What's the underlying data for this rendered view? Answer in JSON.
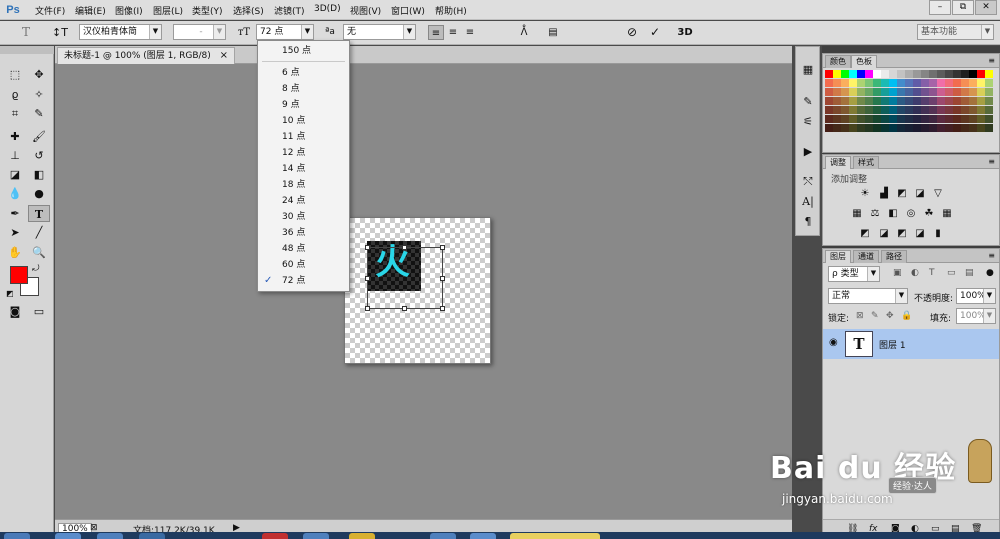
{
  "app": {
    "logo": "Ps"
  },
  "menubar": {
    "items": [
      "文件(F)",
      "编辑(E)",
      "图像(I)",
      "图层(L)",
      "类型(Y)",
      "选择(S)",
      "滤镜(T)",
      "3D(D)",
      "视图(V)",
      "窗口(W)",
      "帮助(H)"
    ],
    "window_buttons": [
      "–",
      "⧉",
      "✕"
    ]
  },
  "options": {
    "font_family": "汉仪柏青体简",
    "font_style": "-",
    "font_size": "72 点",
    "aa_label": "ªa",
    "aa_method": "无",
    "text_color": "#ff0000",
    "workspace": "基本功能",
    "commit_icon": "✓",
    "cancel_icon": "⊘",
    "mode_3d": "3D"
  },
  "font_size_menu": {
    "items": [
      "150 点",
      "6 点",
      "8 点",
      "9 点",
      "10 点",
      "11 点",
      "12 点",
      "14 点",
      "18 点",
      "24 点",
      "30 点",
      "36 点",
      "48 点",
      "60 点",
      "72 点"
    ],
    "selected": "72 点",
    "check": "✓"
  },
  "document": {
    "tab_title": "未标题-1 @ 100% (图层 1, RGB/8)",
    "close_icon": "×",
    "glyph": "火",
    "glyph_color": "#29d6e8"
  },
  "statusbar": {
    "zoom": "100%",
    "doc_info": "文档:117.2K/39.1K"
  },
  "colors_panel": {
    "tabs": [
      "颜色",
      "色板"
    ],
    "active_tab": "色板"
  },
  "adjustments_panel": {
    "tabs": [
      "调整",
      "样式"
    ],
    "title": "添加调整"
  },
  "layers_panel": {
    "tabs": [
      "图层",
      "通道",
      "路径"
    ],
    "filter": "ρ 类型",
    "blend_mode": "正常",
    "opacity_label": "不透明度:",
    "opacity_value": "100%",
    "lock_label": "锁定:",
    "fill_label": "填充:",
    "fill_value": "100%",
    "layers": [
      {
        "name": "图层 1",
        "thumb": "T",
        "visible_icon": "◉"
      }
    ],
    "footer_icons": [
      "⛓",
      "fx",
      "◙",
      "◐",
      "▭",
      "▤",
      "🗑"
    ]
  },
  "watermark": {
    "brand": "Bai du 经验",
    "url": "jingyan.baidu.com",
    "badge": "经验·达人"
  }
}
